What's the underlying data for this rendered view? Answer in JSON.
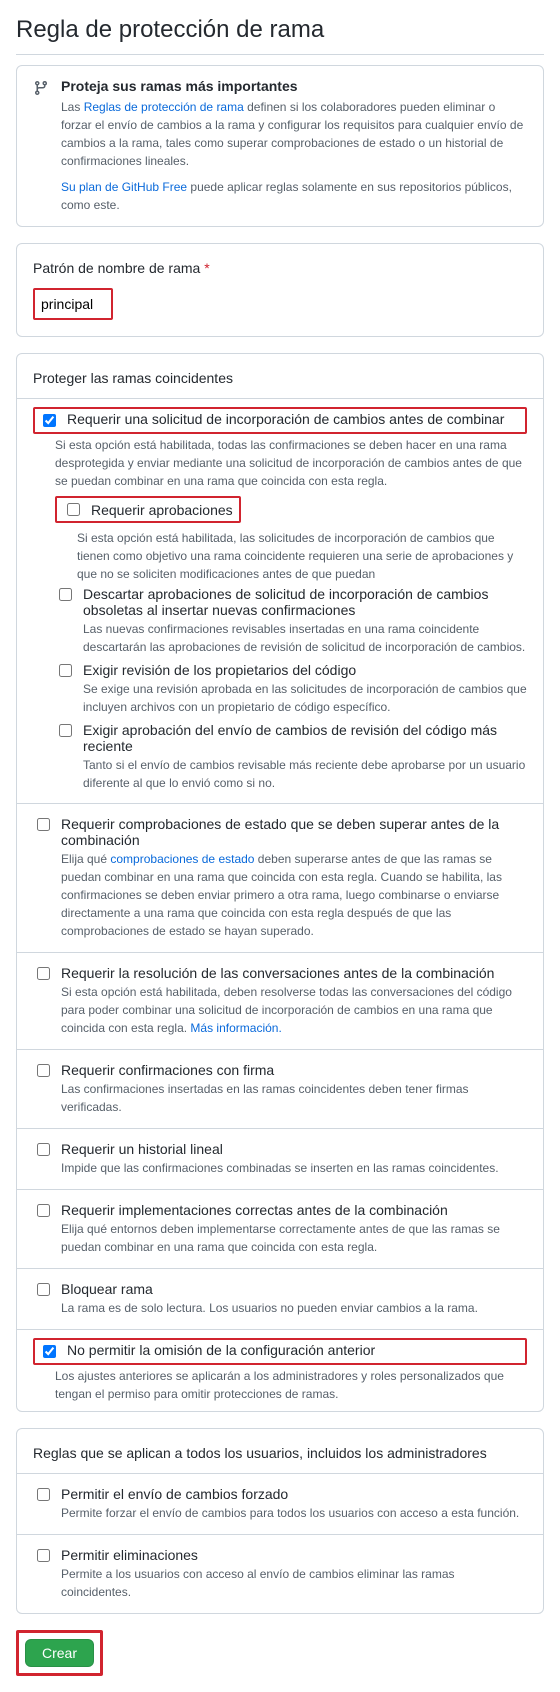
{
  "page_title": "Regla de protección de rama",
  "info": {
    "heading": "Proteja sus ramas más importantes",
    "p1_prefix": "Las ",
    "p1_link": "Reglas de protección de rama",
    "p1_suffix": " definen si los colaboradores pueden eliminar o forzar el envío de cambios a la rama y configurar los requisitos para cualquier envío de cambios a la rama, tales como superar comprobaciones de estado o un historial de confirmaciones lineales.",
    "p2_link": "Su plan de GitHub Free",
    "p2_suffix": " puede aplicar reglas solamente en sus repositorios públicos, como este."
  },
  "pattern": {
    "label": "Patrón de nombre de rama",
    "value": "principal"
  },
  "protect": {
    "header": "Proteger las ramas coincidentes",
    "require_pr": {
      "label": "Requerir una solicitud de incorporación de cambios antes de combinar",
      "desc": "Si esta opción está habilitada, todas las confirmaciones se deben hacer en una rama desprotegida y enviar mediante una solicitud de incorporación de cambios antes de que se puedan combinar en una rama que coincida con esta regla."
    },
    "require_approvals": {
      "label": "Requerir aprobaciones",
      "desc": "Si esta opción está habilitada, las solicitudes de incorporación de cambios que tienen como objetivo una rama coincidente requieren una serie de aprobaciones y que no se soliciten modificaciones antes de que puedan"
    },
    "dismiss_stale": {
      "label": "Descartar aprobaciones de solicitud de incorporación de cambios obsoletas al insertar nuevas confirmaciones",
      "desc": "Las nuevas confirmaciones revisables insertadas en una rama coincidente descartarán las aprobaciones de revisión de solicitud de incorporación de cambios."
    },
    "codeowners": {
      "label": "Exigir revisión de los propietarios del código",
      "desc": "Se exige una revisión aprobada en las solicitudes de incorporación de cambios que incluyen archivos con un propietario de código específico."
    },
    "last_push": {
      "label": "Exigir aprobación del envío de cambios de revisión del código más reciente",
      "desc": "Tanto si el envío de cambios revisable más reciente debe aprobarse por un usuario diferente al que lo envió como si no."
    },
    "status_checks": {
      "label": "Requerir comprobaciones de estado que se deben superar antes de la combinación",
      "desc_prefix": "Elija qué ",
      "desc_link": "comprobaciones de estado",
      "desc_suffix": " deben superarse antes de que las ramas se puedan combinar en una rama que coincida con esta regla. Cuando se habilita, las confirmaciones se deben enviar primero a otra rama, luego combinarse o enviarse directamente a una rama que coincida con esta regla después de que las comprobaciones de estado se hayan superado."
    },
    "conversations": {
      "label": "Requerir la resolución de las conversaciones antes de la combinación",
      "desc_prefix": "Si esta opción está habilitada, deben resolverse todas las conversaciones del código para poder combinar una solicitud de incorporación de cambios en una rama que coincida con esta regla. ",
      "desc_link": "Más información."
    },
    "signed": {
      "label": "Requerir confirmaciones con firma",
      "desc": "Las confirmaciones insertadas en las ramas coincidentes deben tener firmas verificadas."
    },
    "linear": {
      "label": "Requerir un historial lineal",
      "desc": "Impide que las confirmaciones combinadas se inserten en las ramas coincidentes."
    },
    "deployments": {
      "label": "Requerir implementaciones correctas antes de la combinación",
      "desc": "Elija qué entornos deben implementarse correctamente antes de que las ramas se puedan combinar en una rama que coincida con esta regla."
    },
    "lock": {
      "label": "Bloquear rama",
      "desc": "La rama es de solo lectura. Los usuarios no pueden enviar cambios a la rama."
    },
    "no_bypass": {
      "label": "No permitir la omisión de la configuración anterior",
      "desc": "Los ajustes anteriores se aplicarán a los administradores y roles personalizados que tengan el permiso para omitir protecciones de ramas."
    }
  },
  "all_users": {
    "header": "Reglas que se aplican a todos los usuarios, incluidos los administradores",
    "force_push": {
      "label": "Permitir el envío de cambios forzado",
      "desc": "Permite forzar el envío de cambios para todos los usuarios con acceso a esta función."
    },
    "deletions": {
      "label": "Permitir eliminaciones",
      "desc": "Permite a los usuarios con acceso al envío de cambios eliminar las ramas coincidentes."
    }
  },
  "create_button": "Crear"
}
